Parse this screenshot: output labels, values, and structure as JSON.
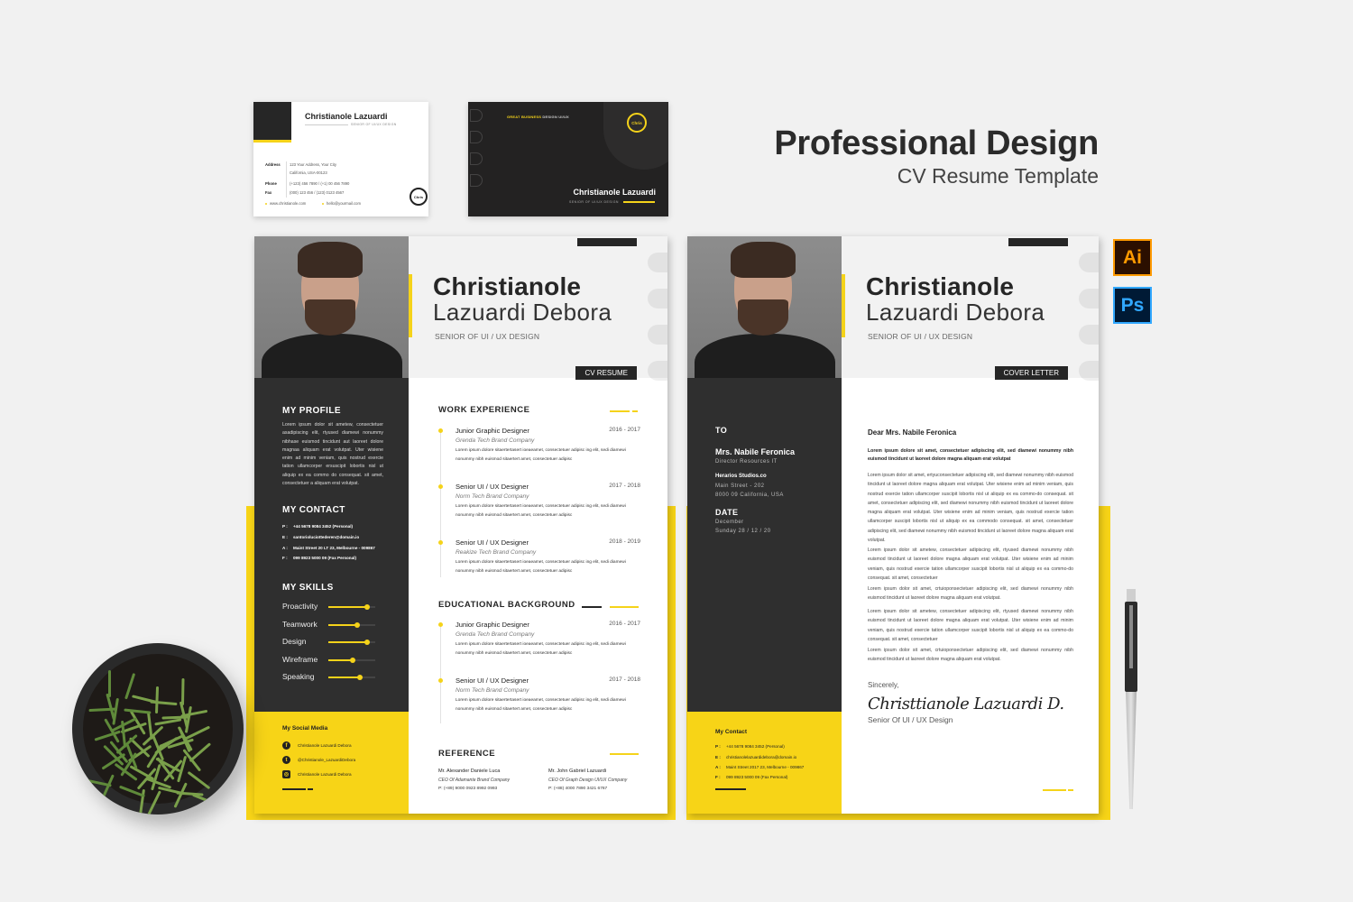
{
  "headline": {
    "title": "Professional Design",
    "subtitle": "CV Resume Template"
  },
  "app_icons": [
    {
      "name": "illustrator",
      "label": "Ai",
      "color": "#ff9a00"
    },
    {
      "name": "photoshop",
      "label": "Ps",
      "color": "#31a8ff"
    }
  ],
  "colors": {
    "accent": "#f5d31a",
    "dark": "#2f2f2f",
    "light": "#f2f2f2"
  },
  "business_card_front": {
    "name": "Christianole Lazuardi",
    "subtitle": "SENIOR OF UI/UX DESIGN",
    "address_label": "Address",
    "address_line1": "123 Your Address, Your City",
    "address_line2": "California, USA-00123",
    "phone_label": "Phone",
    "phone": "(+123) 456 7890 / (+1) 00 456 7890",
    "fax_label": "Fax",
    "fax": "(000) 123 456 / (123) 0123 4567",
    "website": "www.christianole.com",
    "email": "hello@yourmail.com",
    "logo": "Chris"
  },
  "business_card_back": {
    "tagline_highlight": "GREAT BUSINESS",
    "tagline_rest": " DESIGN UI/UX",
    "logo": "Chris",
    "name": "Christianole Lazuardi",
    "subtitle": "SENIOR OF UI/UX DESIGN"
  },
  "cv": {
    "first_name": "Christianole",
    "last_name": "Lazuardi Debora",
    "role": "SENIOR OF UI / UX DESIGN",
    "tag": "CV RESUME",
    "profile": {
      "heading": "MY PROFILE",
      "text": "Lorem ipsum dolor sit ametew, consectetuer asadipiscing elit, rtyused diamewi nonummy nibhase euismod tincidunt aut laoreet dolore magnaa aliquam erat volutpat. Uter wisiene enim ad minim veniam, quis nostrud exercie tation ullamcorper ersuscipit lobortis nisl ut aliquip ex ea commo do consequat. sit amet, consectetuer a aliquam erat volutpat."
    },
    "contact": {
      "heading": "MY CONTACT",
      "items": [
        {
          "key": "P :",
          "value": "+44 5678 9084 3452 (Personal)"
        },
        {
          "key": "E :",
          "value": "santorioluciottederen@domain.io"
        },
        {
          "key": "A :",
          "value": "Maint Street 20 LT 23, Melbourne - 009867"
        },
        {
          "key": "F :",
          "value": "099 8923 5000 09 (Fax Personal)"
        }
      ]
    },
    "skills": {
      "heading": "MY SKILLS",
      "items": [
        {
          "label": "Proactivity",
          "level": 0.82
        },
        {
          "label": "Teamwork",
          "level": 0.61
        },
        {
          "label": "Design",
          "level": 0.82
        },
        {
          "label": "Wireframe",
          "level": 0.52
        },
        {
          "label": "Speaking",
          "level": 0.68
        }
      ]
    },
    "social": {
      "heading": "My Social Media",
      "items": [
        {
          "icon": "facebook-icon",
          "glyph": "f",
          "label": "Christianole Lazuardi Debora"
        },
        {
          "icon": "twitter-icon",
          "glyph": "t",
          "label": "@Christianole_LazuardiDebora"
        },
        {
          "icon": "instagram-icon",
          "glyph": "◎",
          "label": "Christianole Lazuardi Debora"
        }
      ]
    },
    "work": {
      "heading": "WORK EXPERIENCE",
      "items": [
        {
          "title": "Junior Graphic Designer",
          "dates": "2016 - 2017",
          "company": "Grenda Tech Brand Company",
          "desc": "Lorem ipsum dolore sitaertertasert ioeaeamet, consectetuer adipisc ing elit, sedi diamewi nonummy nibh euismod sitaertert amet, consectetuer adipisc"
        },
        {
          "title": "Senior UI / UX Designer",
          "dates": "2017 - 2018",
          "company": "Norm Tech Brand Company",
          "desc": "Lorem ipsum dolore sitaertertasert ioeaeamet, consectetuer adipisc ing elit, sedi diamewi nonummy nibh euismod sitaertert amet, consectetuer adipisc"
        },
        {
          "title": "Senior UI / UX Designer",
          "dates": "2018 - 2019",
          "company": "Reakize Tech Brand Company",
          "desc": "Lorem ipsum dolore sitaertertasert ioeaeamet, consectetuer adipisc ing elit, sedi diamewi nonummy nibh euismod sitaertert amet, consectetuer adipisc"
        }
      ]
    },
    "education": {
      "heading": "EDUCATIONAL BACKGROUND",
      "items": [
        {
          "title": "Junior Graphic Designer",
          "dates": "2016 - 2017",
          "company": "Grenda Tech Brand Company",
          "desc": "Lorem ipsum dolore sitaertertasert ioeaeamet, consectetuer adipisc ing elit, sedi diamewi nonummy nibh euismod sitaertert amet, consectetuer adipisc"
        },
        {
          "title": "Senior UI / UX Designer",
          "dates": "2017 - 2018",
          "company": "Norm Tech Brand Company",
          "desc": "Lorem ipsum dolore sitaertertasert ioeaeamet, consectetuer adipisc ing elit, sedi diamewi nonummy nibh euismod sitaertert amet, consectetuer adipisc"
        }
      ]
    },
    "reference": {
      "heading": "REFERENCE",
      "items": [
        {
          "name": "Mr. Alexander Daniele Luca",
          "role": "CEO Of Adamante Brand Company",
          "phone": "P: (+89) 9000 0923 8992 0993"
        },
        {
          "name": "Mr. John Gabriel Lazuardi",
          "role": "CEO Of Graph Design UI/UX Company",
          "phone": "P: (+88) 4000 7890 3421 6767"
        }
      ]
    }
  },
  "cover_letter": {
    "first_name": "Christianole",
    "last_name": "Lazuardi Debora",
    "role": "SENIOR OF UI / UX DESIGN",
    "tag": "COVER LETTER",
    "to": {
      "heading": "TO",
      "name": "Mrs. Nabile Feronica",
      "title": "Director Resources IT",
      "company": "Herarios Studios.co",
      "address1": "Main Street - 202",
      "address2": "8000 09 California, USA"
    },
    "date": {
      "heading": "DATE",
      "month": "December",
      "day": "Sunday 28 / 12 / 20"
    },
    "contact": {
      "heading": "My Contact",
      "items": [
        {
          "key": "P :",
          "value": "+44 5678 9084 3452 (Personal)"
        },
        {
          "key": "E :",
          "value": "christianolelazuardidebora@domain.io"
        },
        {
          "key": "A :",
          "value": "Maint Street 2017 23, Melbourne - 009867"
        },
        {
          "key": "F :",
          "value": "099 8923 5000 09 (Fax Personal)"
        }
      ]
    },
    "salutation": "Dear Mrs. Nabile Feronica",
    "lead": "Lorem ipsum dolore sit amet, consectetuer adipiscing elit, sed diamewi nonummy nibh euismod tincidunt ut laoreet dolore magna aliquam erat volutpat",
    "paragraphs": [
      "Lorem ipsum dolor sit amet, ertyuconsectetuer adipiscing elit, sed diamewi nonummy nibh euismod tincidunt ut laoreet dolore magna aliquam erat volutpat. Uter wisiene enim ad minim veniam, quis nostrud exercie tation ullamcorper suscipit lobortis nisl ut aliquip ex ea commo-do consequat. sit amet, consectetuer adipiscing elit, sed diamewi nonummy nibh euismod tincidunt ut laoreet dolore magna aliquam erat volutpat. Uter wisiene enim ad minim veniam, quis nostrud exercie tation ullamcorper suscipit lobortis nisl ut aliquip ex ea commodo consequat.  sit amet, consectetuer adipiscing elit, sed diamewi nonummy nibh euismod tincidunt ut laoreet dolore magna aliquam erat volutpat.",
      "Lorem ipsum dolor sit ametew, consectetuer adipiscing elit, rtyused diamewi nonummy nibh euismod tincidunt ut laoreet dolore magna aliquam erat volutpat. Uter wisiene enim ad minim veniam, quis nostrud exercie tation ullamcorper suscipit lobortis nisl ut aliquip ex ea commo-do consequat. sit amet, consectetuer",
      "Lorem ipsum dolor sit amet, crtuioponsectetuer adipiscing elit, sed diamewi nonummy nibh euismod tincidunt ut laoreet dolore magna aliquam erat volutpat.",
      "Lorem ipsum dolor sit ametew, consectetuer adipiscing elit, rtyused diamewi nonummy nibh euismod tincidunt ut laoreet dolore magna aliquam erat volutpat. Uter wisiene enim ad minim veniam, quis nostrud exercie tation ullamcorper suscipit lobortis nisl ut aliquip ex ea commo-do consequat. sit amet, consectetuer",
      "Lorem ipsum dolor sit amet, crtuioponsectetuer adipiscing elit, sed diamewi nonummy nibh euismod tincidunt ut laoreet dolore magna aliquam erat volutpat."
    ],
    "closing": "Sincerely,",
    "signature": "Christtianole Lazuardi D.",
    "signature_role": "Senior Of UI / UX Design"
  }
}
